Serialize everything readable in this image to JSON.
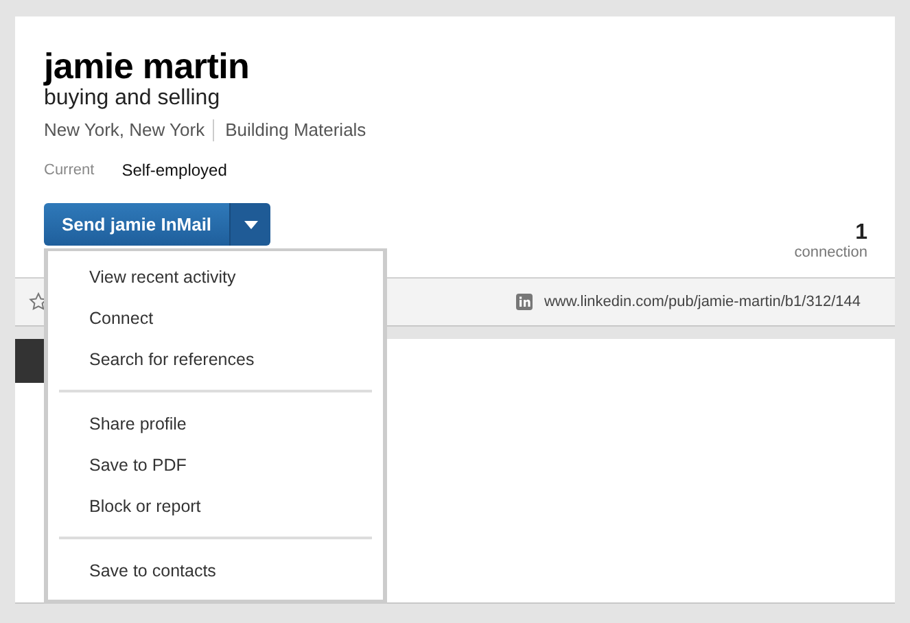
{
  "profile": {
    "name": "jamie martin",
    "headline": "buying and selling",
    "location": "New York, New York",
    "industry": "Building Materials",
    "current_label": "Current",
    "current_value": "Self-employed"
  },
  "inmail_button": {
    "label": "Send jamie InMail"
  },
  "connections": {
    "count": "1",
    "label": "connection"
  },
  "profile_url": "www.linkedin.com/pub/jamie-martin/b1/312/144",
  "menu": {
    "groups": [
      {
        "items": [
          "View recent activity",
          "Connect",
          "Search for references"
        ]
      },
      {
        "items": [
          "Share profile",
          "Save to PDF",
          "Block or report"
        ]
      },
      {
        "items": [
          "Save to contacts"
        ]
      }
    ]
  }
}
